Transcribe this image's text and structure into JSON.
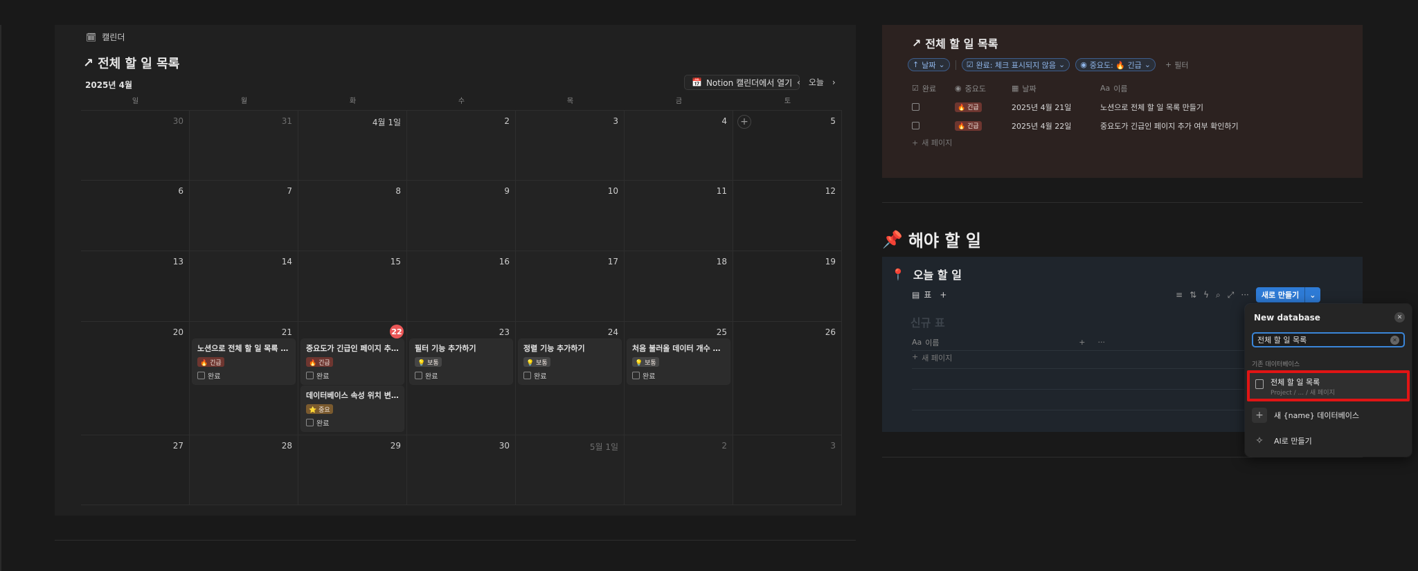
{
  "calendar": {
    "view_tab": "캘린더",
    "title": "전체 할 일 목록",
    "month_label": "2025년 4월",
    "open_button": "Notion 캘린더에서 열기",
    "today_button": "오늘",
    "weekdays": [
      "일",
      "월",
      "화",
      "수",
      "목",
      "금",
      "토"
    ],
    "weeks": [
      [
        "30",
        "31",
        "4월 1일",
        "2",
        "3",
        "4",
        "5"
      ],
      [
        "6",
        "7",
        "8",
        "9",
        "10",
        "11",
        "12"
      ],
      [
        "13",
        "14",
        "15",
        "16",
        "17",
        "18",
        "19"
      ],
      [
        "20",
        "21",
        "22",
        "23",
        "24",
        "25",
        "26"
      ],
      [
        "27",
        "28",
        "29",
        "30",
        "5월 1일",
        "2",
        "3"
      ]
    ],
    "cards": {
      "c21": {
        "title": "노션으로 전체 할 일 목록 만...",
        "tag": "🔥 긴급",
        "check": "완료"
      },
      "c22a": {
        "title": "중요도가 긴급인 페이지 추...",
        "tag": "🔥 긴급",
        "check": "완료"
      },
      "c22b": {
        "title": "데이터베이스 속성 위치 변...",
        "tag": "⭐ 중요",
        "check": "완료"
      },
      "c23": {
        "title": "필터 기능 추가하기",
        "tag": "💡 보통",
        "check": "완료"
      },
      "c24": {
        "title": "정렬 기능 추가하기",
        "tag": "💡 보통",
        "check": "완료"
      },
      "c25": {
        "title": "처음 불러올 데이터 개수 지...",
        "tag": "💡 보통",
        "check": "완료"
      }
    }
  },
  "linked_db": {
    "title": "전체 할 일 목록",
    "chips": {
      "date": "날짜",
      "done": "완료: 체크 표시되지 않음",
      "priority": "중요도: 🔥 긴급",
      "filter": "필터"
    },
    "columns": {
      "done": "완료",
      "priority": "중요도",
      "date": "날짜",
      "name": "이름"
    },
    "rows": [
      {
        "priority": "🔥 긴급",
        "date": "2025년 4월 21일",
        "name": "노션으로 전체 할 일 목록 만들기"
      },
      {
        "priority": "🔥 긴급",
        "date": "2025년 4월 22일",
        "name": "중요도가 긴급인 페이지 추가 여부 확인하기"
      }
    ],
    "new_page": "새 페이지"
  },
  "section": {
    "title": "해야 할 일"
  },
  "todo_db": {
    "title": "오늘 할 일",
    "view_tab": "표",
    "new_button": "새로 만들기",
    "ghost_title": "신규 표",
    "column_name": "이름",
    "new_page": "새 페이지"
  },
  "popover": {
    "title": "New database",
    "search_value": "전체 할 일 목록",
    "section_label": "기존 데이터베이스",
    "selected_item": {
      "name": "전체 할 일 목록",
      "path": "Project / ... / 새 페이지"
    },
    "new_db_label": "새 {name} 데이터베이스",
    "ai_label": "AI로 만들기"
  },
  "colors": {
    "accent": "#2e7bd6",
    "today": "#eb5757",
    "highlight": "#e01515"
  }
}
